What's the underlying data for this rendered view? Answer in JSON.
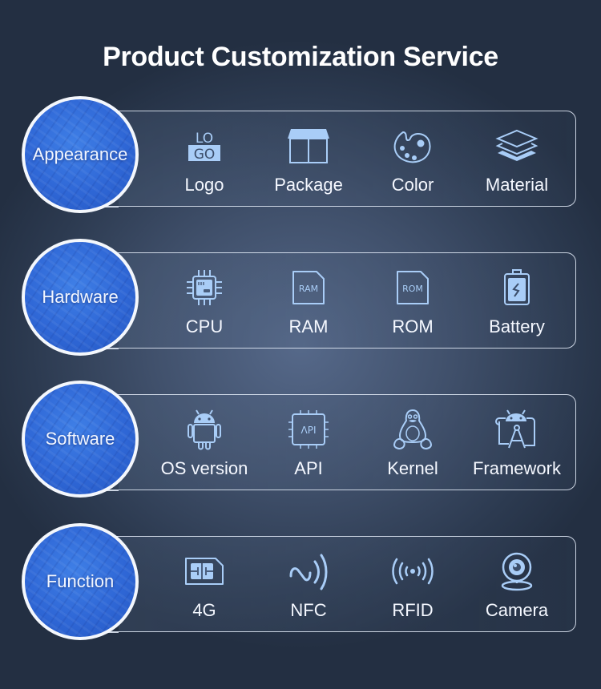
{
  "page": {
    "title": "Product Customization Service"
  },
  "colors": {
    "icon_accent": "#a9cdf7",
    "circle_blue": "#2f67d6",
    "text": "#ffffff"
  },
  "categories": [
    {
      "name": "Appearance",
      "items": [
        {
          "label": "Logo",
          "icon": "logo-icon",
          "icon_text_top": "LO",
          "icon_text_bottom": "GO"
        },
        {
          "label": "Package",
          "icon": "package-box-icon"
        },
        {
          "label": "Color",
          "icon": "palette-icon"
        },
        {
          "label": "Material",
          "icon": "layers-icon"
        }
      ]
    },
    {
      "name": "Hardware",
      "items": [
        {
          "label": "CPU",
          "icon": "cpu-chip-icon"
        },
        {
          "label": "RAM",
          "icon": "ram-card-icon",
          "icon_text": "RAM"
        },
        {
          "label": "ROM",
          "icon": "rom-card-icon",
          "icon_text": "ROM"
        },
        {
          "label": "Battery",
          "icon": "battery-icon"
        }
      ]
    },
    {
      "name": "Software",
      "items": [
        {
          "label": "OS version",
          "icon": "android-icon"
        },
        {
          "label": "API",
          "icon": "api-chip-icon",
          "icon_text": "ΛPI"
        },
        {
          "label": "Kernel",
          "icon": "linux-penguin-icon"
        },
        {
          "label": "Framework",
          "icon": "android-studio-icon"
        }
      ]
    },
    {
      "name": "Function",
      "items": [
        {
          "label": "4G",
          "icon": "sim-card-icon"
        },
        {
          "label": "NFC",
          "icon": "nfc-icon"
        },
        {
          "label": "RFID",
          "icon": "rfid-signal-icon"
        },
        {
          "label": "Camera",
          "icon": "webcam-icon"
        }
      ]
    }
  ]
}
